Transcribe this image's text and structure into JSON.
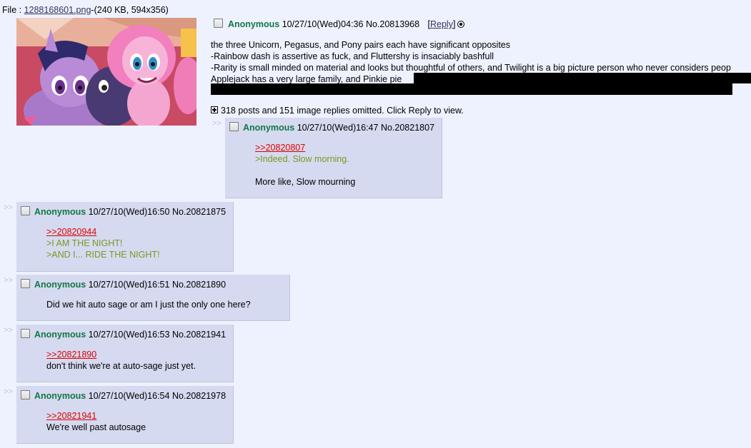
{
  "file": {
    "prefix": "File : ",
    "filename": "1288168601.png",
    "meta": "-(240 KB, 594x356)"
  },
  "op": {
    "name": "Anonymous",
    "datetime": "10/27/10(Wed)04:36",
    "number": "No.20813968",
    "reply_open": "[",
    "reply_label": "Reply",
    "reply_close": "]",
    "lines": [
      "the three Unicorn, Pegasus, and Pony pairs each have significant opposites",
      "-Rainbow dash is assertive as fuck, and Fluttershy is insaciably bashfull",
      "-Rarity is small minded on material and looks but thoughtful of others, and Twilight is a big picture person who never considers peop",
      "Applejack has a very large family, and Pinkie pie"
    ],
    "omitted": "318 posts and 151 image replies omitted. Click Reply to view."
  },
  "replies": [
    {
      "name": "Anonymous",
      "datetime": "10/27/10(Wed)16:47",
      "number": "No.20821807",
      "quotelink": ">>20820807",
      "greentext": [
        ">Indeed. Slow morning."
      ],
      "text": [
        "More like, Slow mourning"
      ]
    },
    {
      "name": "Anonymous",
      "datetime": "10/27/10(Wed)16:50",
      "number": "No.20821875",
      "quotelink": ">>20820944",
      "greentext": [
        ">I AM THE NIGHT!",
        ">AND I... RIDE THE NIGHT!"
      ],
      "text": []
    },
    {
      "name": "Anonymous",
      "datetime": "10/27/10(Wed)16:51",
      "number": "No.20821890",
      "quotelink": "",
      "greentext": [],
      "text": [
        "Did we hit auto sage or am I just the only one here?"
      ]
    },
    {
      "name": "Anonymous",
      "datetime": "10/27/10(Wed)16:53",
      "number": "No.20821941",
      "quotelink": ">>20821890",
      "greentext": [],
      "text": [
        "don't think we're at auto-sage just yet."
      ]
    },
    {
      "name": "Anonymous",
      "datetime": "10/27/10(Wed)16:54",
      "number": "No.20821978",
      "quotelink": ">>20821941",
      "greentext": [],
      "text": [
        "We're well past autosage"
      ]
    }
  ],
  "doubledash": ">>",
  "colors": {
    "background": "#EEF2FF",
    "reply_bg": "#D6DAF0",
    "name": "#117743",
    "quotelink": "#DD0000",
    "greentext": "#789922"
  },
  "icons": {
    "omit": "plus-box-icon",
    "report": "report-circle-icon"
  }
}
